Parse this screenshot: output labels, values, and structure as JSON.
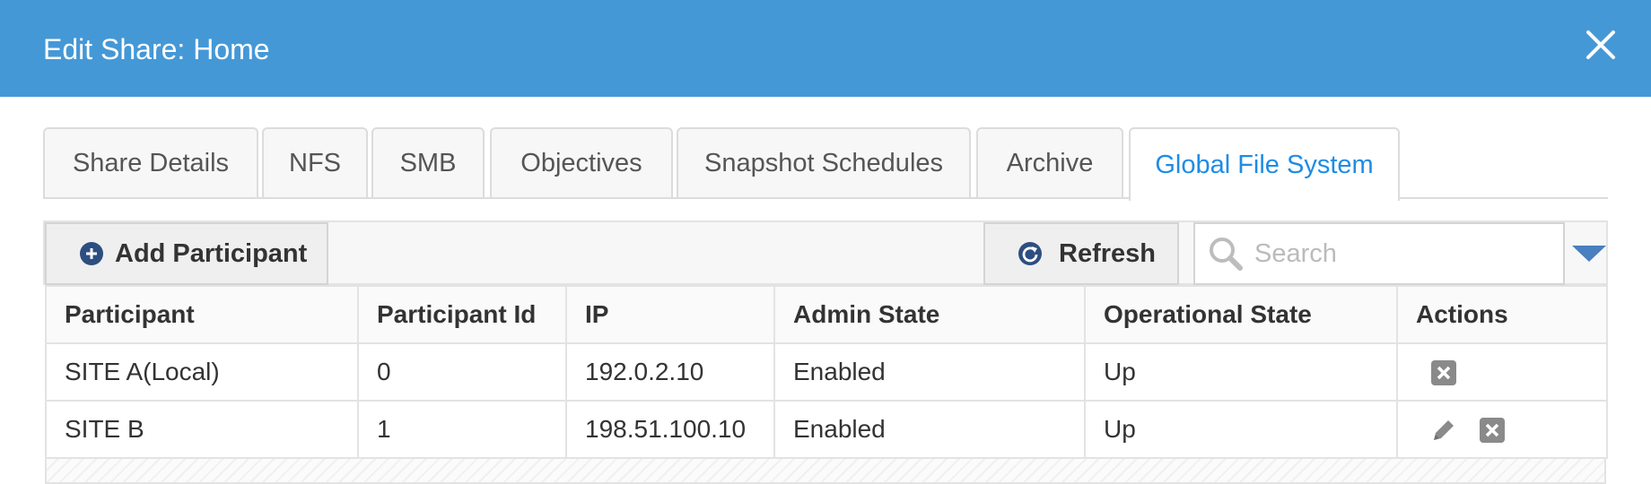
{
  "header": {
    "title": "Edit Share: Home"
  },
  "tabs": [
    {
      "label": "Share Details",
      "active": false
    },
    {
      "label": "NFS",
      "active": false
    },
    {
      "label": "SMB",
      "active": false
    },
    {
      "label": "Objectives",
      "active": false
    },
    {
      "label": "Snapshot Schedules",
      "active": false
    },
    {
      "label": "Archive",
      "active": false
    },
    {
      "label": "Global File System",
      "active": true
    }
  ],
  "toolbar": {
    "add_label": "Add Participant",
    "refresh_label": "Refresh",
    "search_placeholder": "Search",
    "search_value": ""
  },
  "table": {
    "columns": [
      "Participant",
      "Participant Id",
      "IP",
      "Admin State",
      "Operational State",
      "Actions"
    ],
    "rows": [
      {
        "participant": "SITE A(Local)",
        "id": "0",
        "ip": "192.0.2.10",
        "admin_state": "Enabled",
        "op_state": "Up",
        "actions": [
          "delete-icon"
        ]
      },
      {
        "participant": "SITE B",
        "id": "1",
        "ip": "198.51.100.10",
        "admin_state": "Enabled",
        "op_state": "Up",
        "actions": [
          "edit-icon",
          "delete-icon"
        ]
      }
    ]
  },
  "colors": {
    "header": "#4598d6",
    "active_tab": "#1e8ce6",
    "icon_blue": "#2d4e80"
  }
}
